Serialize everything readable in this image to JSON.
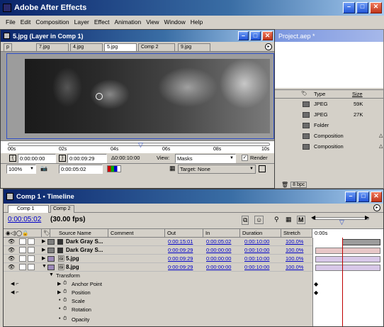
{
  "app": {
    "title": "Adobe After Effects"
  },
  "menu": [
    "File",
    "Edit",
    "Composition",
    "Layer",
    "Effect",
    "Animation",
    "View",
    "Window",
    "Help"
  ],
  "layer_window": {
    "title": "5.jpg (Layer in Comp 1)",
    "tabs": [
      "p",
      "7.jpg",
      "4.jpg",
      "5.jpg",
      "Comp 2",
      "9.jpg"
    ],
    "ruler_ticks": [
      "00s",
      "02s",
      "04s",
      "06s",
      "08s",
      "10s"
    ],
    "in_time": "0:00:00:00",
    "out_time": "0:00:09:29",
    "duration": "Δ0:00:10:00",
    "view_label": "View:",
    "view_value": "Masks",
    "render_label": "Render",
    "zoom": "100%",
    "current_time": "0:00:05:02",
    "target_label": "Target: None"
  },
  "project": {
    "title": "Project.aep *",
    "columns": {
      "type": "Type",
      "size": "Size"
    },
    "items": [
      {
        "type": "JPEG",
        "size": "59K"
      },
      {
        "type": "JPEG",
        "size": "27K"
      },
      {
        "type": "Folder",
        "size": ""
      },
      {
        "type": "Composition",
        "size": ""
      },
      {
        "type": "Composition",
        "size": ""
      }
    ],
    "bpc": "8 bpc"
  },
  "timeline": {
    "title": "Comp 1 • Timeline",
    "tabs": [
      "Comp 1",
      "Comp 2"
    ],
    "current_time": "0:00:05:02",
    "fps": "(30.00 fps)",
    "columns": {
      "source_name": "Source Name",
      "comment": "Comment",
      "out": "Out",
      "in": "In",
      "duration": "Duration",
      "stretch": "Stretch",
      "time_start": "0:00s"
    },
    "layers": [
      {
        "name": "Dark Gray S...",
        "out": "0:00:15:01",
        "in": "0:00:05:02",
        "duration": "0:00:10:00",
        "stretch": "100.0%"
      },
      {
        "name": "Dark Gray S...",
        "out": "0:00:09:29",
        "in": "0:00:00:00",
        "duration": "0:00:10:00",
        "stretch": "100.0%"
      },
      {
        "name": "5.jpg",
        "out": "0:00:09:29",
        "in": "0:00:00:00",
        "duration": "0:00:10:00",
        "stretch": "100.0%"
      },
      {
        "name": "8.jpg",
        "out": "0:00:09:29",
        "in": "0:00:00:00",
        "duration": "0:00:10:00",
        "stretch": "100.0%"
      }
    ],
    "properties": {
      "group": "Transform",
      "items": [
        "Anchor Point",
        "Position",
        "Scale",
        "Rotation",
        "Opacity"
      ]
    }
  },
  "colors": {
    "title_active": "#0a246a",
    "link_blue": "#0000c8",
    "playhead": "#c00000",
    "bar_pink": "#e8c8c8",
    "bar_lavender": "#d8c8e8"
  }
}
